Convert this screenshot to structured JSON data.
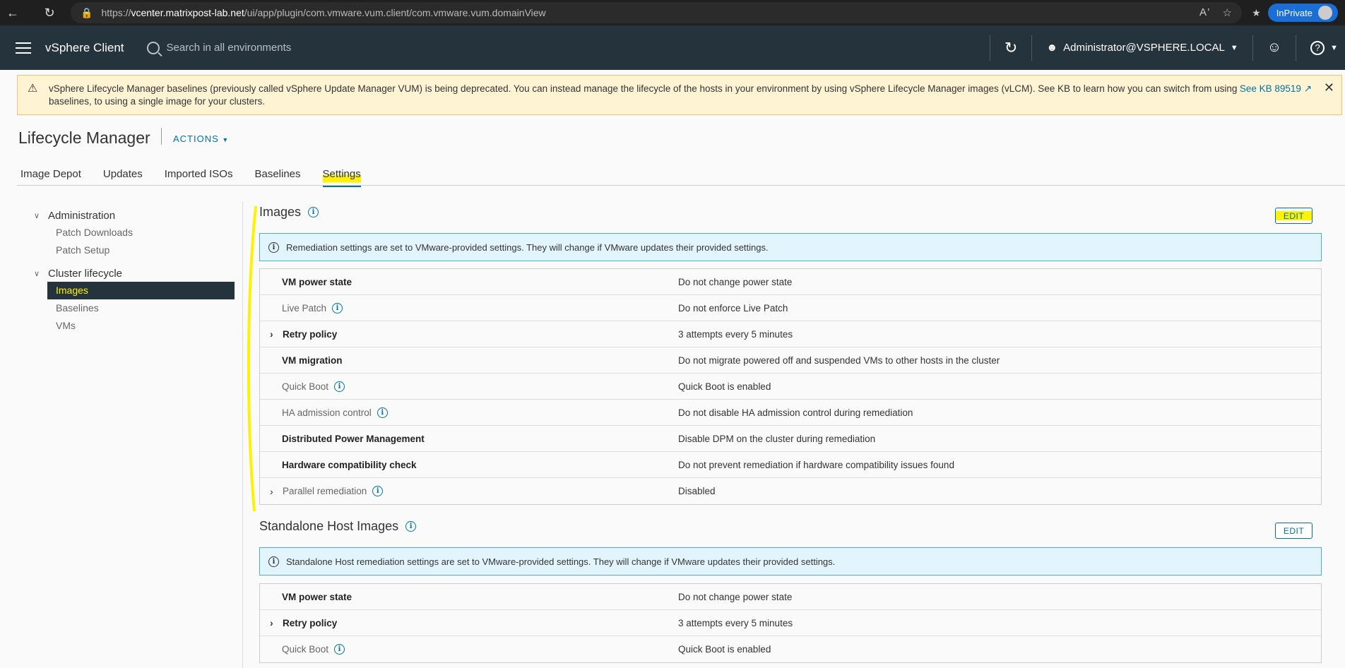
{
  "browser": {
    "url_prefix": "https://",
    "url_host": "vcenter.matrixpost-lab.net",
    "url_path": "/ui/app/plugin/com.vmware.vum.client/com.vmware.vum.domainView",
    "inprivate_label": "InPrivate"
  },
  "header": {
    "app_title": "vSphere Client",
    "search_placeholder": "Search in all environments",
    "user": "Administrator@VSPHERE.LOCAL"
  },
  "banner": {
    "text": "vSphere Lifecycle Manager baselines (previously called vSphere Update Manager VUM) is being deprecated. You can instead manage the lifecycle of the hosts in your environment by using vSphere Lifecycle Manager images (vLCM). See KB to learn how you can switch from using baselines, to using a single image for your clusters.",
    "link": "See KB 89519"
  },
  "page": {
    "title": "Lifecycle Manager",
    "actions": "ACTIONS"
  },
  "tabs": [
    "Image Depot",
    "Updates",
    "Imported ISOs",
    "Baselines",
    "Settings"
  ],
  "nav": {
    "group1": "Administration",
    "group1_items": [
      "Patch Downloads",
      "Patch Setup"
    ],
    "group2": "Cluster lifecycle",
    "group2_items": [
      "Images",
      "Baselines",
      "VMs"
    ]
  },
  "images": {
    "title": "Images",
    "edit": "EDIT",
    "info": "Remediation settings are set to VMware-provided settings. They will change if VMware updates their provided settings.",
    "rows": [
      {
        "key": "VM power state",
        "value": "Do not change power state"
      },
      {
        "key": "Live Patch",
        "value": "Do not enforce Live Patch"
      },
      {
        "key": "Retry policy",
        "value": "3 attempts every 5 minutes"
      },
      {
        "key": "VM migration",
        "value": "Do not migrate powered off and suspended VMs to other hosts in the cluster"
      },
      {
        "key": "Quick Boot",
        "value": "Quick Boot is enabled"
      },
      {
        "key": "HA admission control",
        "value": "Do not disable HA admission control during remediation"
      },
      {
        "key": "Distributed Power Management",
        "value": "Disable DPM on the cluster during remediation"
      },
      {
        "key": "Hardware compatibility check",
        "value": "Do not prevent remediation if hardware compatibility issues found"
      },
      {
        "key": "Parallel remediation",
        "value": "Disabled"
      }
    ]
  },
  "standalone": {
    "title": "Standalone Host Images",
    "edit": "EDIT",
    "info": "Standalone Host remediation settings are set to VMware-provided settings. They will change if VMware updates their provided settings.",
    "rows": [
      {
        "key": "VM power state",
        "value": "Do not change power state"
      },
      {
        "key": "Retry policy",
        "value": "3 attempts every 5 minutes"
      },
      {
        "key": "Quick Boot",
        "value": "Quick Boot is enabled"
      }
    ]
  },
  "colors": {
    "header_bg": "#25333d",
    "accent": "#0072a3",
    "highlight": "#fff200",
    "banner_bg": "#fef3d3"
  }
}
